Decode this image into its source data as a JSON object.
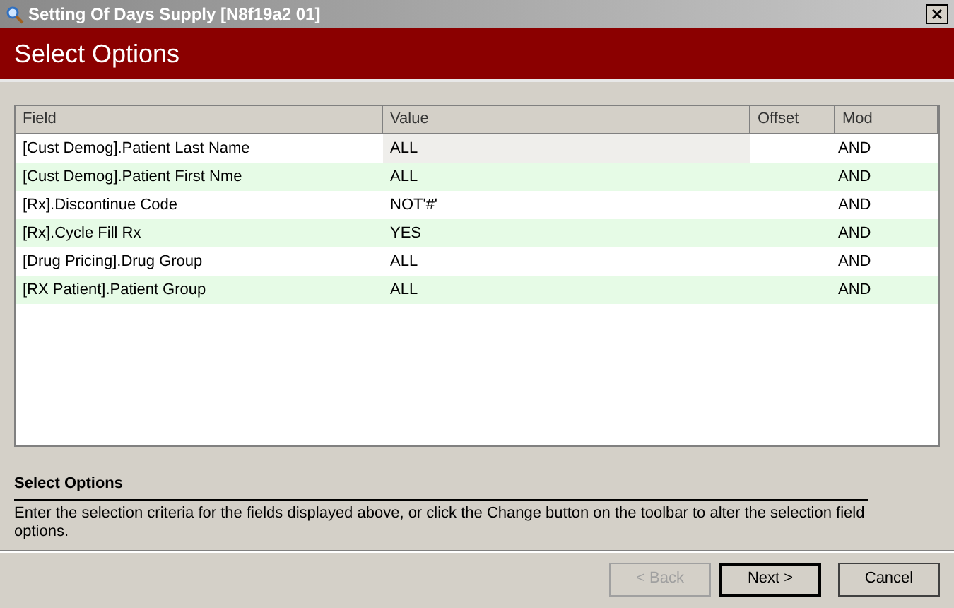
{
  "window": {
    "title": "Setting Of Days Supply [N8f19a2 01]"
  },
  "header": {
    "title": "Select Options"
  },
  "table": {
    "columns": [
      "Field",
      "Value",
      "Offset",
      "Mod"
    ],
    "rows": [
      {
        "field": "[Cust Demog].Patient Last Name",
        "value": "ALL",
        "mod": "AND",
        "selected": true
      },
      {
        "field": "[Cust Demog].Patient First Nme",
        "value": "ALL",
        "mod": "AND",
        "selected": false
      },
      {
        "field": "[Rx].Discontinue Code",
        "value": "NOT'#'",
        "mod": "AND",
        "selected": false
      },
      {
        "field": "[Rx].Cycle Fill Rx",
        "value": "YES",
        "mod": "AND",
        "selected": false
      },
      {
        "field": "[Drug Pricing].Drug Group",
        "value": "ALL",
        "mod": "AND",
        "selected": false
      },
      {
        "field": "[RX Patient].Patient Group",
        "value": "ALL",
        "mod": "AND",
        "selected": false
      }
    ]
  },
  "help": {
    "title": "Select Options",
    "text": "Enter the selection criteria for the fields displayed above, or click the Change button on the toolbar to alter the selection field options."
  },
  "buttons": [
    {
      "label": "< Back",
      "disabled": true
    },
    {
      "label": "Next >",
      "disabled": false,
      "default": true
    },
    {
      "label": "Cancel",
      "disabled": false,
      "default": false
    }
  ]
}
